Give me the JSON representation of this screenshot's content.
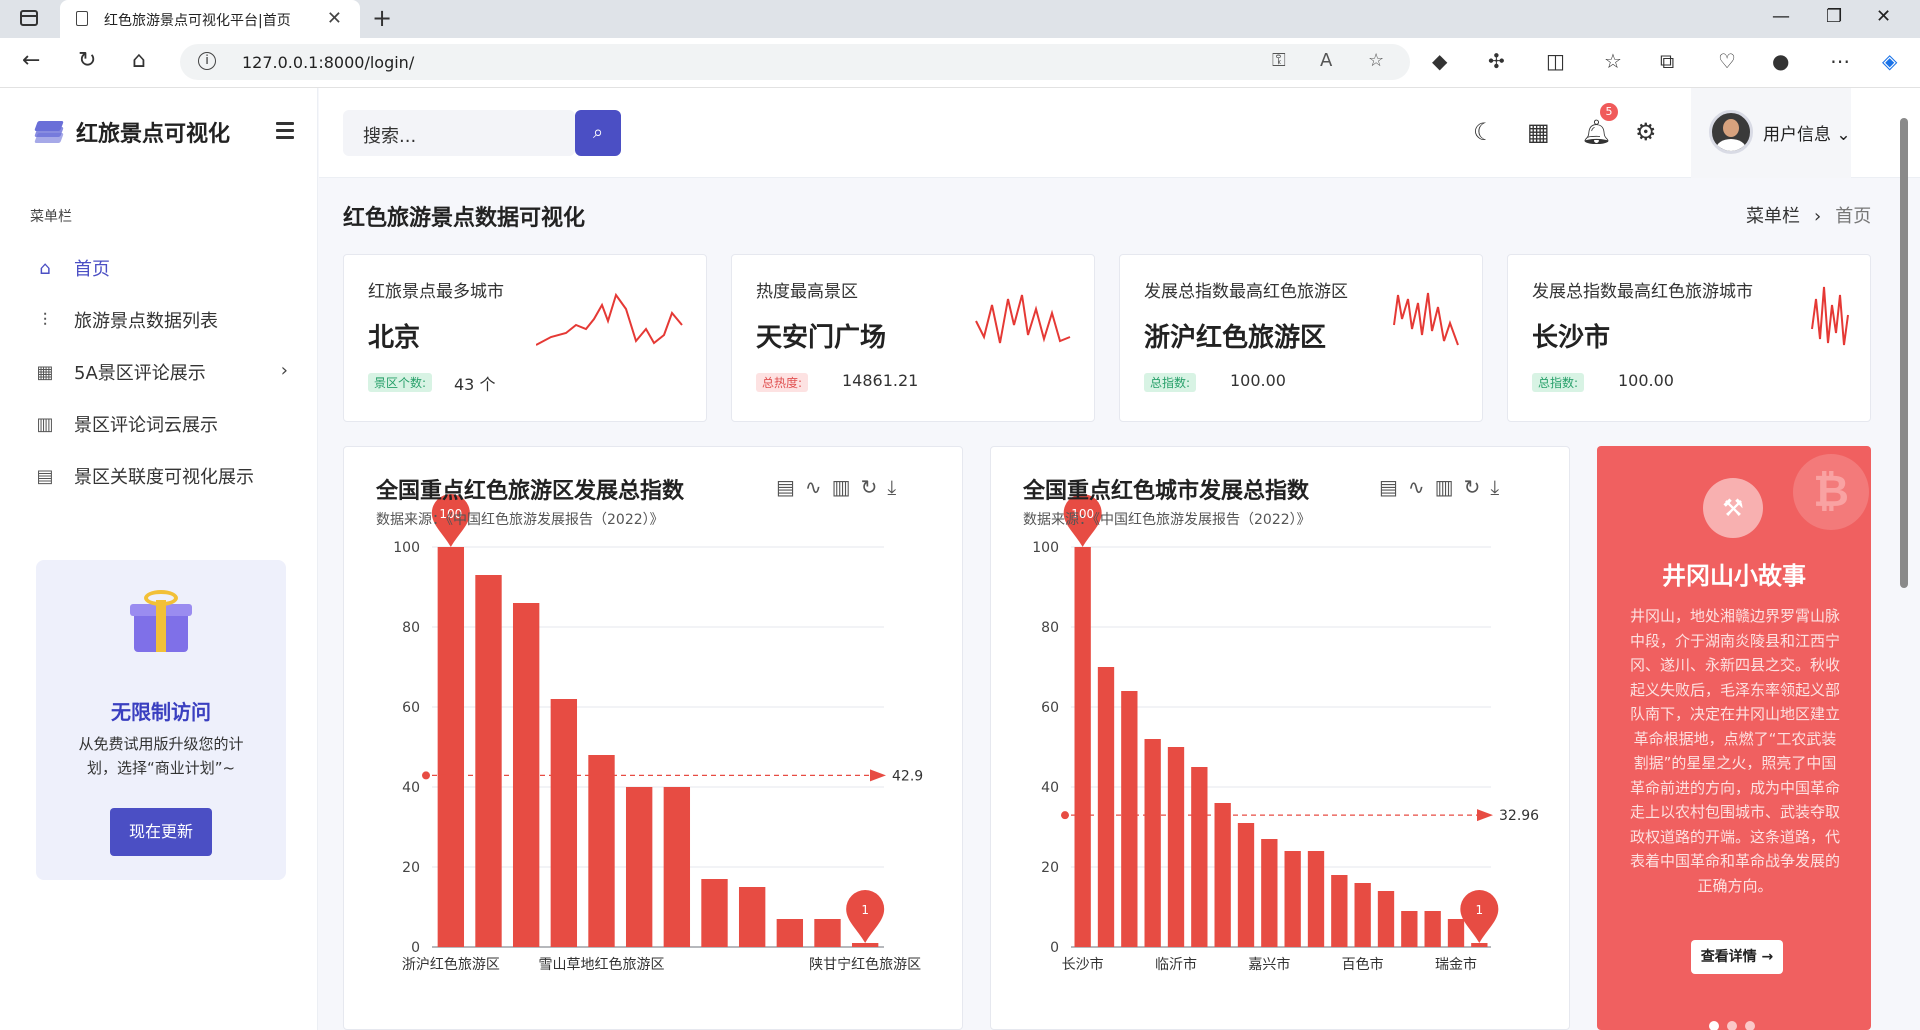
{
  "browser": {
    "tab_title": "红色旅游景点可视化平台|首页",
    "url": "127.0.0.1:8000/login/"
  },
  "sidebar": {
    "brand": "红旅景点可视化",
    "menu_caption": "菜单栏",
    "items": [
      {
        "label": "首页",
        "icon": "home-icon"
      },
      {
        "label": "旅游景点数据列表",
        "icon": "sliders-icon"
      },
      {
        "label": "5A景区评论展示",
        "icon": "grid-icon"
      },
      {
        "label": "景区评论词云展示",
        "icon": "map-icon"
      },
      {
        "label": "景区关联度可视化展示",
        "icon": "document-icon"
      }
    ],
    "promo": {
      "title": "无限制访问",
      "desc": "从免费试用版升级您的计划，选择“商业计划”~",
      "button": "现在更新"
    }
  },
  "topbar": {
    "search_placeholder": "搜索...",
    "notification_count": "5",
    "user_label": "用户信息"
  },
  "main": {
    "title": "红色旅游景点数据可视化",
    "breadcrumb": [
      "菜单栏",
      "首页"
    ]
  },
  "cards": [
    {
      "label": "红旅景点最多城市",
      "value": "北京",
      "tag": "景区个数:",
      "num": "43 个",
      "tag_color": "green"
    },
    {
      "label": "热度最高景区",
      "value": "天安门广场",
      "tag": "总热度:",
      "num": "14861.21",
      "tag_color": "red"
    },
    {
      "label": "发展总指数最高红色旅游区",
      "value": "浙沪红色旅游区",
      "tag": "总指数:",
      "num": "100.00",
      "tag_color": "green"
    },
    {
      "label": "发展总指数最高红色旅游城市",
      "value": "长沙市",
      "tag": "总指数:",
      "num": "100.00",
      "tag_color": "green"
    }
  ],
  "chart_data": [
    {
      "type": "bar",
      "title": "全国重点红色旅游区发展总指数",
      "subtitle": "数据来源：《中国红色旅游发展报告（2022）》",
      "categories": [
        "浙沪红色旅游区",
        "",
        "",
        "",
        "雪山草地红色旅游区",
        "",
        "",
        "",
        "",
        "",
        "",
        "陕甘宁红色旅游区"
      ],
      "values": [
        100,
        93,
        86,
        62,
        48,
        40,
        40,
        17,
        15,
        7,
        7,
        1
      ],
      "ylim": [
        0,
        100
      ],
      "yticks": [
        0,
        20,
        40,
        60,
        80,
        100
      ],
      "markers": {
        "max": "100",
        "min": "1",
        "average": "42.9"
      },
      "color": "#e74c43"
    },
    {
      "type": "bar",
      "title": "全国重点红色城市发展总指数",
      "subtitle": "数据来源：《中国红色旅游发展报告（2022）》",
      "categories": [
        "长沙市",
        "",
        "",
        "",
        "临沂市",
        "",
        "",
        "",
        "嘉兴市",
        "",
        "",
        "",
        "百色市",
        "",
        "",
        "",
        "瑞金市",
        ""
      ],
      "values": [
        100,
        70,
        64,
        52,
        50,
        45,
        36,
        31,
        27,
        24,
        24,
        18,
        16,
        14,
        9,
        9,
        7,
        1
      ],
      "ylim": [
        0,
        100
      ],
      "yticks": [
        0,
        20,
        40,
        60,
        80,
        100
      ],
      "markers": {
        "max": "100",
        "min": "1",
        "average": "32.96"
      },
      "color": "#e74c43"
    }
  ],
  "story": {
    "title": "井冈山小故事",
    "text": "井冈山，地处湘赣边界罗霄山脉中段，介于湖南炎陵县和江西宁冈、遂川、永新四县之交。秋收起义失败后，毛泽东率领起义部队南下，决定在井冈山地区建立革命根据地，点燃了“工农武装割据”的星星之火，照亮了中国革命前进的方向，成为中国革命走上以农村包围城市、武装夺取政权道路的开端。这条道路，代表着中国革命和革命战争发展的正确方向。",
    "button": "查看详情"
  }
}
